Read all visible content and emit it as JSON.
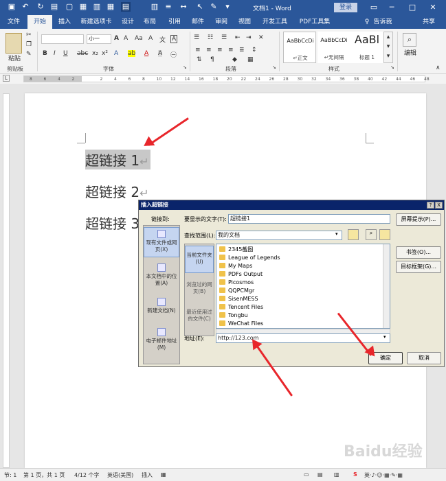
{
  "titlebar": {
    "title": "文档1 - Word",
    "signin": "登录",
    "minimize": "─",
    "restore": "□",
    "close": "✕"
  },
  "tabs": [
    {
      "label": "文件"
    },
    {
      "label": "开始"
    },
    {
      "label": "插入"
    },
    {
      "label": "新建选项卡"
    },
    {
      "label": "设计"
    },
    {
      "label": "布局"
    },
    {
      "label": "引用"
    },
    {
      "label": "邮件"
    },
    {
      "label": "审阅"
    },
    {
      "label": "视图"
    },
    {
      "label": "开发工具"
    },
    {
      "label": "PDF工具集"
    },
    {
      "label": "告诉我"
    },
    {
      "label": "共享"
    }
  ],
  "ribbon": {
    "clipboard": {
      "paste": "粘贴",
      "label": "剪贴板"
    },
    "font": {
      "name_value": "",
      "size_value": "小一",
      "label": "字体"
    },
    "paragraph": {
      "label": "段落"
    },
    "styles": {
      "label": "样式",
      "items": [
        {
          "sample": "AaBbCcDi",
          "name": "↵正文"
        },
        {
          "sample": "AaBbCcDi",
          "name": "↵无间隔"
        },
        {
          "sample": "AaBl",
          "name": "标题 1"
        }
      ]
    },
    "edit": {
      "label": "编辑"
    }
  },
  "ruler": {
    "numbers": [
      "8",
      "6",
      "4",
      "2",
      "",
      "2",
      "4",
      "6",
      "8",
      "10",
      "12",
      "14",
      "16",
      "18",
      "20",
      "22",
      "24",
      "26",
      "28",
      "30",
      "32",
      "34",
      "36",
      "38",
      "40",
      "42",
      "44",
      "46",
      "48"
    ]
  },
  "document": {
    "lines": [
      "超链接 1",
      "超链接 2",
      "超链接 3"
    ],
    "para_mark": "↵"
  },
  "dialog": {
    "title": "插入超链接",
    "help": "?",
    "close": "X",
    "link_to_label": "链接到:",
    "link_to": [
      {
        "label": "现有文件或网页(X)"
      },
      {
        "label": "本文档中的位置(A)"
      },
      {
        "label": "新建文档(N)"
      },
      {
        "label": "电子邮件地址(M)"
      }
    ],
    "display_text_label": "要显示的文字(T):",
    "display_text_value": "超链接1",
    "screentip_button": "屏幕提示(P)...",
    "look_in_label": "查找范围(L):",
    "look_in_value": "我的文档",
    "side_nav": [
      {
        "label": "当前文件夹(U)"
      },
      {
        "label": "浏览过的网页(B)"
      },
      {
        "label": "最近使用过的文件(C)"
      }
    ],
    "files": [
      "2345截图",
      "League of Legends",
      "My Maps",
      "PDFs Output",
      "Picosmos",
      "QQPCMgr",
      "SisenMESS",
      "Tencent Files",
      "Tongbu",
      "WeChat Files"
    ],
    "bookmark_button": "书签(O)...",
    "target_frame_button": "目标框架(G)...",
    "address_label": "地址(E):",
    "address_value": "http://123.com",
    "ok_button": "确定",
    "cancel_button": "取消"
  },
  "statusbar": {
    "section": "节: 1",
    "page": "第 1 页，共 1 页",
    "words": "4/12 个字",
    "language": "英语(美国)",
    "mode": "插入"
  },
  "watermark": "Baidu经验",
  "colors": {
    "word_blue": "#2b579a",
    "arrow_red": "#e8262b",
    "dialog_bg": "#ece9d8"
  }
}
